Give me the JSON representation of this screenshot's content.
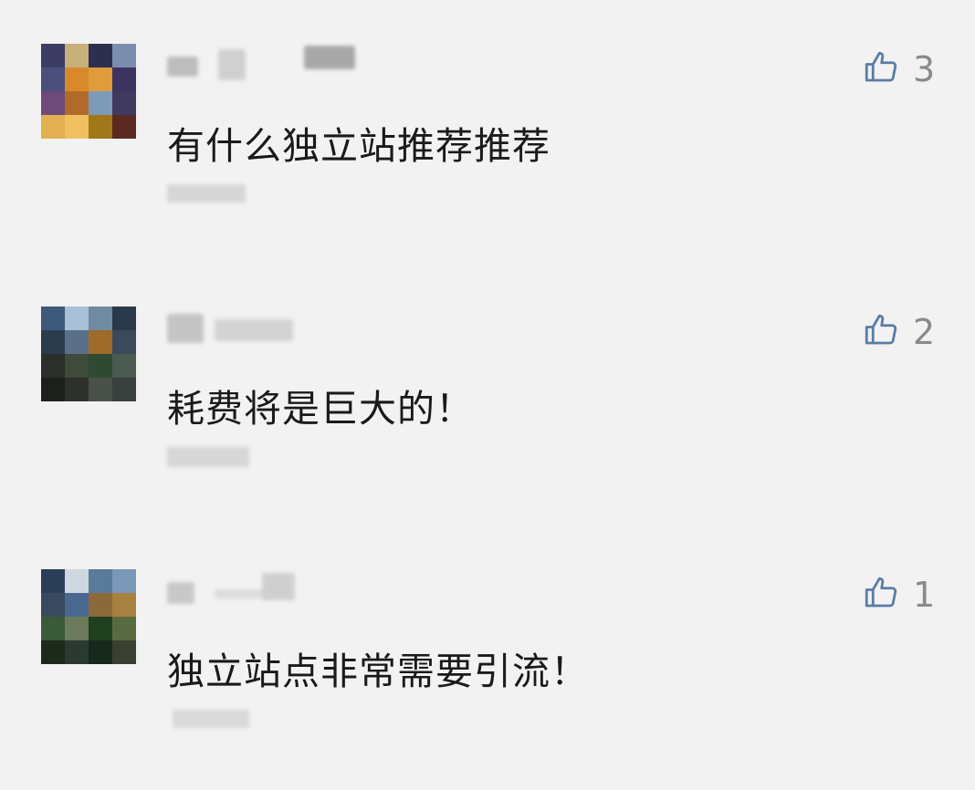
{
  "comments": [
    {
      "text": "有什么独立站推荐推荐",
      "likes": "3",
      "avatar_colors": [
        "#3b3d63",
        "#c8b07a",
        "#2d2f4e",
        "#7a8fb0",
        "#4a4f7c",
        "#d88a2a",
        "#e09b3a",
        "#3c3460",
        "#6d4a7a",
        "#b06b2a",
        "#7d9bb8",
        "#403a5e",
        "#e2b050",
        "#f0c060",
        "#a0781a",
        "#5a2a20"
      ]
    },
    {
      "text": "耗费将是巨大的！",
      "likes": "2",
      "avatar_colors": [
        "#3e5a7a",
        "#a8c0d8",
        "#708aa0",
        "#2a3a4a",
        "#2c3c4a",
        "#5a7088",
        "#a06a2a",
        "#3a4a5a",
        "#2a2f2a",
        "#3f4a3a",
        "#2f4a30",
        "#4a5a50",
        "#1c1f1c",
        "#2e302c",
        "#4a5248",
        "#3a4040"
      ]
    },
    {
      "text": "独立站点非常需要引流！",
      "likes": "1",
      "avatar_colors": [
        "#2a3e58",
        "#cfd8e0",
        "#5a7a9a",
        "#7a98b8",
        "#3a4a5e",
        "#4a6890",
        "#8a6a3a",
        "#a88040",
        "#3a5a3a",
        "#6a7a5a",
        "#204020",
        "#5a6a40",
        "#1c2a1c",
        "#2a3a30",
        "#18281c",
        "#3a4030"
      ]
    }
  ],
  "colors": {
    "background": "#f2f2f2",
    "like_icon": "#5a7da6",
    "like_count": "#8a8a8a",
    "text": "#1a1a1a"
  },
  "icons": {
    "like": "thumbs-up-icon"
  }
}
